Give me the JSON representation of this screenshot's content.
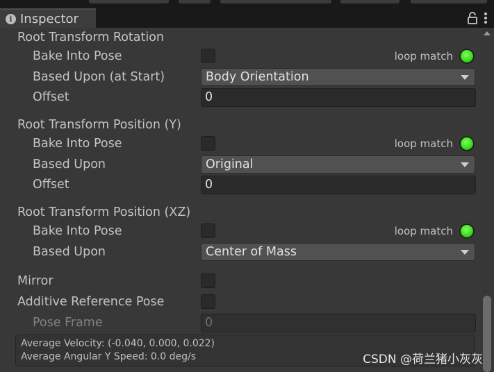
{
  "tab": {
    "title": "Inspector"
  },
  "rotation": {
    "heading": "Root Transform Rotation",
    "bake_label": "Bake Into Pose",
    "loop_label": "loop match",
    "based_label": "Based Upon (at Start)",
    "based_value": "Body Orientation",
    "offset_label": "Offset",
    "offset_value": "0"
  },
  "position_y": {
    "heading": "Root Transform Position (Y)",
    "bake_label": "Bake Into Pose",
    "loop_label": "loop match",
    "based_label": "Based Upon",
    "based_value": "Original",
    "offset_label": "Offset",
    "offset_value": "0"
  },
  "position_xz": {
    "heading": "Root Transform Position (XZ)",
    "bake_label": "Bake Into Pose",
    "loop_label": "loop match",
    "based_label": "Based Upon",
    "based_value": "Center of Mass"
  },
  "mirror": {
    "label": "Mirror"
  },
  "additive": {
    "label": "Additive Reference Pose",
    "pose_frame_label": "Pose Frame",
    "pose_frame_value": "0"
  },
  "info": {
    "velocity": "Average Velocity: (-0.040, 0.000, 0.022)",
    "angular": "Average Angular Y Speed: 0.0 deg/s"
  },
  "watermark": "CSDN @荷兰猪小灰灰",
  "colors": {
    "loop_match": "#3de022",
    "background": "#383838"
  }
}
